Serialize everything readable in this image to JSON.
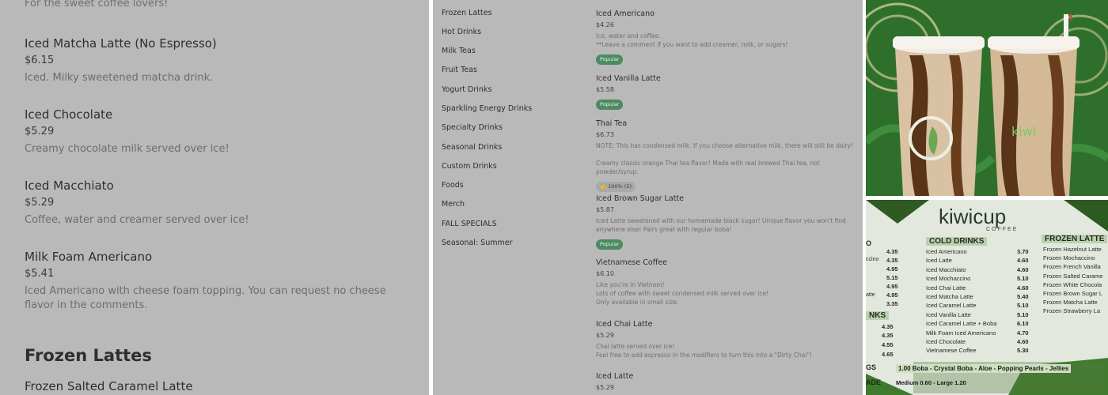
{
  "left": {
    "intro": "For the sweet coffee lovers!",
    "items": [
      {
        "name": "Iced Matcha Latte (No Espresso)",
        "price": "$6.15",
        "desc": "Iced. Milky sweetened matcha drink."
      },
      {
        "name": "Iced Chocolate",
        "price": "$5.29",
        "desc": "Creamy chocolate milk served over ice!"
      },
      {
        "name": "Iced Macchiato",
        "price": "$5.29",
        "desc": "Coffee, water and creamer served over ice!"
      },
      {
        "name": "Milk Foam Americano",
        "price": "$5.41",
        "desc": "Iced Americano with cheese foam topping. You can request no cheese flavor in the comments."
      }
    ],
    "section_title": "Frozen Lattes",
    "next_item": "Frozen Salted Caramel Latte"
  },
  "middle": {
    "categories": [
      "Frozen Lattes",
      "Hot Drinks",
      "Milk Teas",
      "Fruit Teas",
      "Yogurt Drinks",
      "Sparkling Energy Drinks",
      "Specialty Drinks",
      "Seasonal Drinks",
      "Custom Drinks",
      "Foods",
      "Merch",
      "FALL SPECIALS",
      "Seasonal: Summer"
    ],
    "items": [
      {
        "name": "Iced Americano",
        "price": "$4.26",
        "desc": "Ice, water and coffee.\n**Leave a comment if you want to add creamer, milk, or sugars!",
        "badge": "Popular"
      },
      {
        "name": "Iced Vanilla Latte",
        "price": "$5.58",
        "desc": "",
        "badge": "Popular"
      },
      {
        "name": "Thai Tea",
        "price": "$6.73",
        "desc": "NOTE: This has condensed milk. If you choose alternative milk, there will still be dairy!\n\nCreamy classic orange Thai tea flavor! Made with real brewed Thai tea, not powder/syrup.",
        "rating": "👍 100% (5)"
      },
      {
        "name": "Iced Brown Sugar Latte",
        "price": "$5.87",
        "desc": "Iced Latte sweetened with our homemade black sugar! Unique flavor you won't find anywhere else! Pairs great with regular boba!",
        "badge": "Popular"
      },
      {
        "name": "Vietnamese Coffee",
        "price": "$6.10",
        "desc": "Like you're in Vietnam!\nLots of coffee with sweet condensed milk served over ice!\nOnly available in small size."
      },
      {
        "name": "Iced Chai Latte",
        "price": "$5.29",
        "desc": "Chai latte served over ice!\nFeel free to add espresso in the modifiers to turn this into a \"Dirty Chai\"!"
      },
      {
        "name": "Iced Latte",
        "price": "$5.29",
        "desc": ""
      }
    ]
  },
  "board": {
    "brand": "kiwicup",
    "brand_sub": "COFFEE",
    "cold_title": "COLD DRINKS",
    "cold": [
      {
        "n": "Iced Americano",
        "p": "3.70"
      },
      {
        "n": "Iced Latte",
        "p": "4.60"
      },
      {
        "n": "Iced Macchiato",
        "p": "4.60"
      },
      {
        "n": "Iced Mochaccino",
        "p": "5.10"
      },
      {
        "n": "Iced Chai Latte",
        "p": "4.60"
      },
      {
        "n": "Iced Matcha Latte",
        "p": "5.40"
      },
      {
        "n": "Iced Caramel Latte",
        "p": "5.10"
      },
      {
        "n": "Iced Vanilla Latte",
        "p": "5.10"
      },
      {
        "n": "Iced Caramel Latte + Boba",
        "p": "6.10"
      },
      {
        "n": "Milk Foam Iced Americano",
        "p": "4.70"
      },
      {
        "n": "Iced Chocolate",
        "p": "4.60"
      },
      {
        "n": "Vietnamese Coffee",
        "p": "5.30"
      }
    ],
    "left_prices": [
      "4.35",
      "4.35",
      "4.95",
      "5.15",
      "4.95",
      "4.95",
      "3.35"
    ],
    "left_labels": [
      "O",
      "ccino",
      "",
      "",
      "",
      "atte",
      ""
    ],
    "left_section": "NKS",
    "left_prices2": [
      "4.35",
      "4.35",
      "4.55",
      "4.65"
    ],
    "frozen_title": "FROZEN LATTE",
    "frozen": [
      "Frozen Hazelnut Latte",
      "Frozen Mochaccino",
      "Frozen French Vanilla",
      "Frozen Salted Carame",
      "Frozen White Chocola",
      "Frozen Brown Sugar L",
      "Frozen Matcha Latte",
      "Frozen Strawberry La"
    ],
    "toppings": "1.00 Boba - Crystal Boba - Aloe - Popping Pearls - Jellies",
    "sizes": "Medium 0.60 - Large 1.20",
    "gs": "GS",
    "ade": "ADE"
  },
  "colors": {
    "badge": "#4d8a62",
    "panel_gray": "#b9b9b9",
    "photo_green": "#2f6f2c"
  }
}
